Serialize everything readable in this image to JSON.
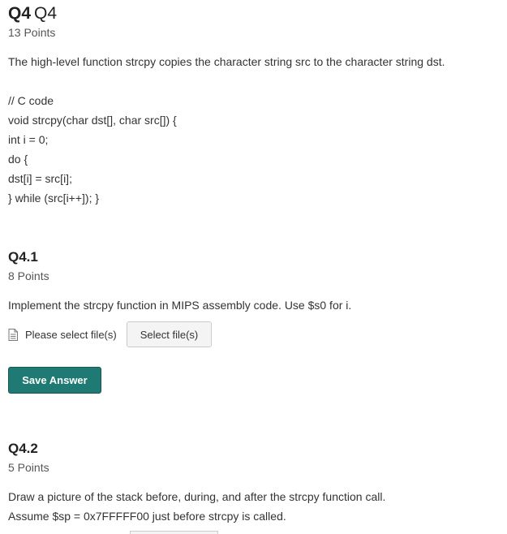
{
  "question": {
    "number": "Q4",
    "title": "Q4",
    "points": "13 Points",
    "prompt": "The high-level function strcpy copies the character string src to the character string dst.",
    "code_lines": [
      "// C code",
      "void strcpy(char dst[], char src[]) {",
      "int i = 0;",
      "do {",
      "dst[i] = src[i];",
      "} while (src[i++]); }"
    ]
  },
  "q41": {
    "heading": "Q4.1",
    "points": "8 Points",
    "prompt": "Implement the strcpy function in MIPS assembly code. Use $s0 for i.",
    "file_label": "Please select file(s)",
    "select_button": "Select file(s)",
    "save_button": "Save Answer"
  },
  "q42": {
    "heading": "Q4.2",
    "points": "5 Points",
    "prompt_lines": [
      "Draw a picture of the stack before, during, and after the strcpy function call.",
      "Assume $sp = 0x7FFFFF00 just before strcpy is called."
    ]
  },
  "colors": {
    "accent": "#1f7a73",
    "text": "#333333",
    "muted": "#555555"
  },
  "icons": {
    "file": "file-icon"
  }
}
